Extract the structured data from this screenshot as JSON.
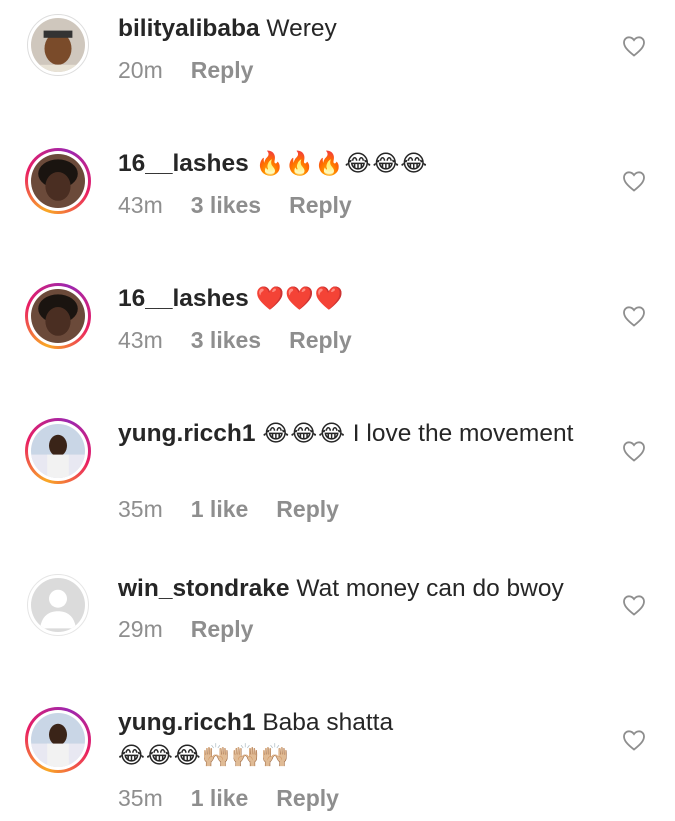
{
  "comments": [
    {
      "username": "bilityalibaba",
      "text": "Werey",
      "emoji": "",
      "time": "20m",
      "likes": "",
      "reply": "Reply"
    },
    {
      "username": "16__lashes",
      "text": "",
      "emoji": "🔥🔥🔥😂😂😂",
      "time": "43m",
      "likes": "3 likes",
      "reply": "Reply"
    },
    {
      "username": "16__lashes",
      "text": "",
      "emoji": "❤️❤️❤️",
      "time": "43m",
      "likes": "3 likes",
      "reply": "Reply"
    },
    {
      "username": "yung.ricch1",
      "text": "I love the movement",
      "emoji": "😂😂😂",
      "time": "35m",
      "likes": "1 like",
      "reply": "Reply"
    },
    {
      "username": "win_stondrake",
      "text": "Wat money can do bwoy",
      "emoji": "",
      "time": "29m",
      "likes": "",
      "reply": "Reply"
    },
    {
      "username": "yung.ricch1",
      "text": "Baba shatta",
      "emoji": "😂😂😂🙌🏼🙌🏼🙌🏼",
      "time": "35m",
      "likes": "1 like",
      "reply": "Reply"
    }
  ],
  "icons": {
    "like": "heart-outline-icon",
    "default_avatar": "person-silhouette-icon"
  },
  "colors": {
    "text": "#262626",
    "meta": "#8e8e8e",
    "story_ring_start": "#f9a825",
    "story_ring_end": "#9c27b0"
  }
}
